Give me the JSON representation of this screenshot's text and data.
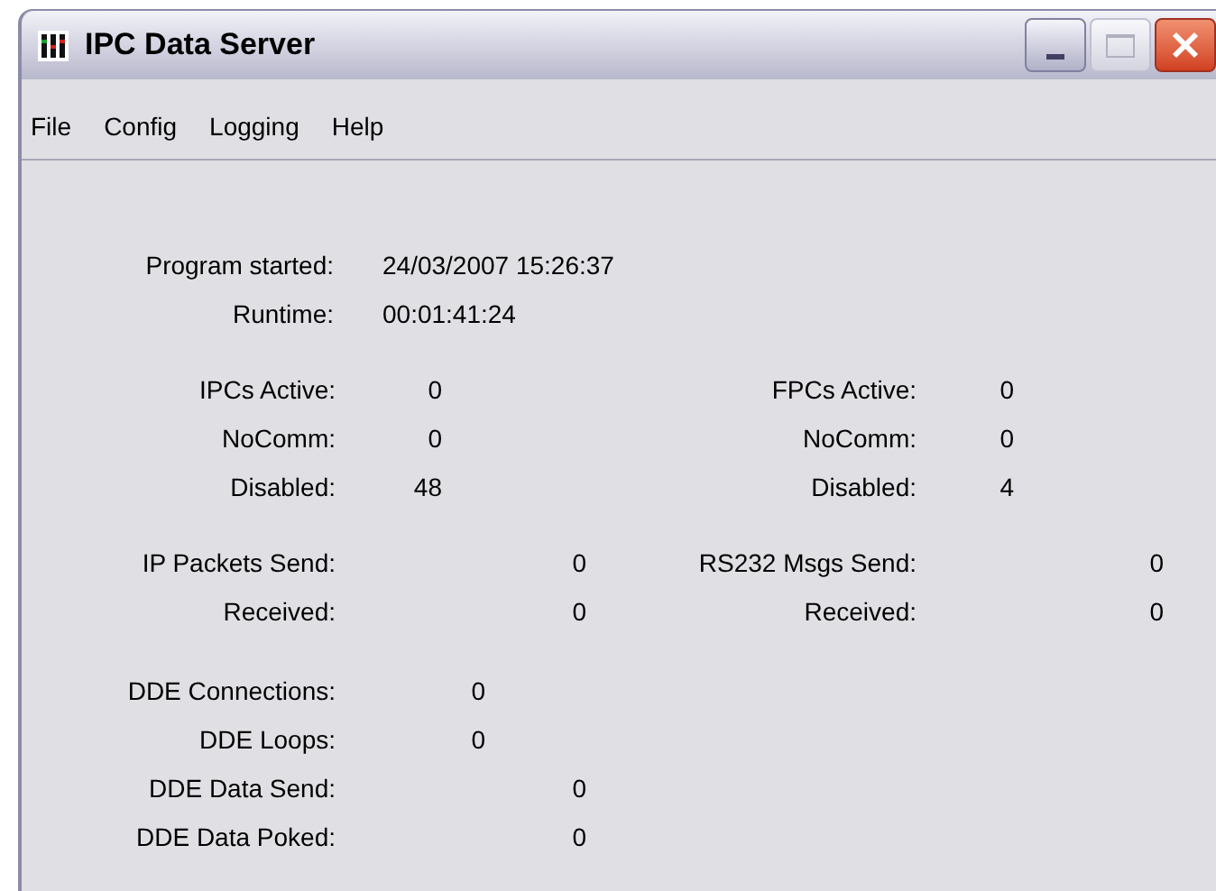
{
  "window": {
    "title": "IPC Data Server"
  },
  "menu": [
    "File",
    "Config",
    "Logging",
    "Help"
  ],
  "sections": [
    {
      "kind": "info",
      "rows": [
        {
          "label": "Program started:",
          "value": "24/03/2007 15:26:37"
        },
        {
          "label": "Runtime:",
          "value": "00:01:41:24"
        }
      ]
    },
    {
      "kind": "counts",
      "rows": [
        {
          "label": "IPCs Active:",
          "value": "0",
          "label_2": "FPCs Active:",
          "value_2": "0"
        },
        {
          "label": "NoComm:",
          "value": "0",
          "label_2": "NoComm:",
          "value_2": "0"
        },
        {
          "label": "Disabled:",
          "value": "48",
          "label_2": "Disabled:",
          "value_2": "4"
        }
      ]
    },
    {
      "kind": "packets",
      "rows": [
        {
          "label": "IP Packets Send:",
          "value": "0",
          "label_2": "RS232 Msgs Send:",
          "value_2": "0"
        },
        {
          "label": "Received:",
          "value": "0",
          "label_2": "Received:",
          "value_2": "0"
        }
      ]
    },
    {
      "kind": "short",
      "rows": [
        {
          "label": "DDE Connections:",
          "value": "0"
        },
        {
          "label": "DDE Loops:",
          "value": "0"
        }
      ]
    },
    {
      "kind": "long",
      "rows": [
        {
          "label": "DDE Data Send:",
          "value": "0"
        },
        {
          "label": "DDE Data Poked:",
          "value": "0"
        }
      ]
    }
  ]
}
